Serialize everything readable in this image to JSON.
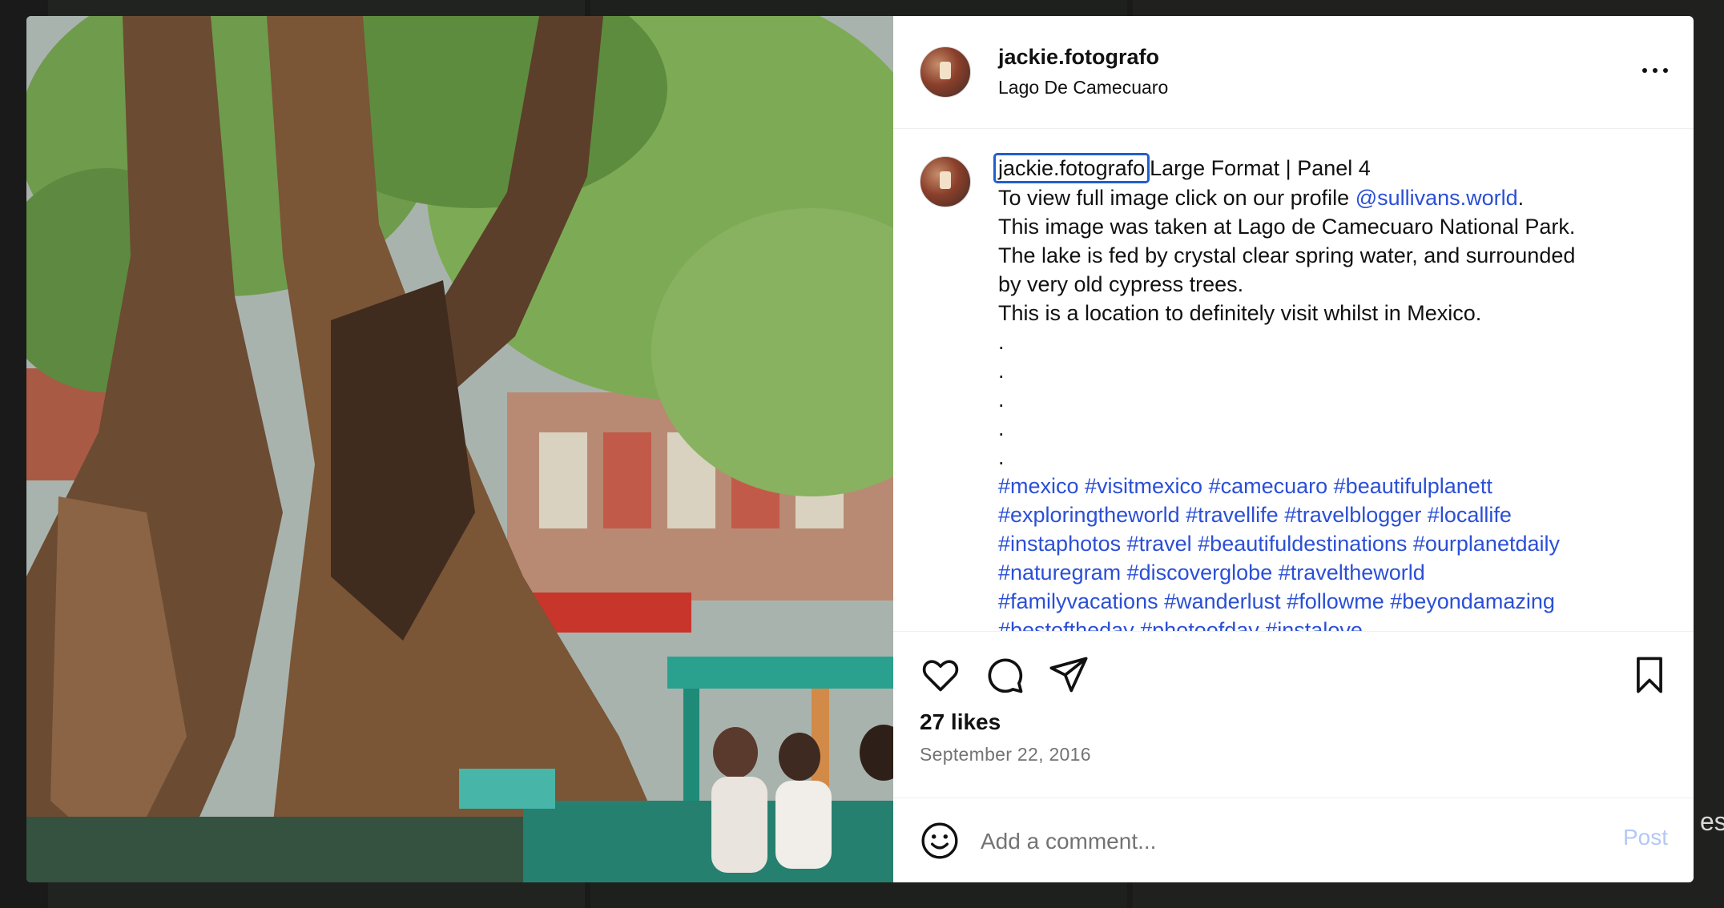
{
  "post": {
    "username": "jackie.fotografo",
    "location": "Lago De Camecuaro",
    "caption": {
      "username": "jackie.fotografo",
      "line1_after_user": "Large Format | Panel 4",
      "line2_text": "To view full image click on our profile ",
      "line2_mention": "@sullivans.world",
      "line2_end": ".",
      "line3": "This image was taken at Lago de Camecuaro National Park.",
      "line4": "The lake is fed by crystal clear spring water, and surrounded",
      "line5": "by very old cypress trees.",
      "line6": "This is a location to definitely visit whilst in Mexico.",
      "dots": [
        ".",
        ".",
        ".",
        ".",
        "."
      ],
      "hashtag_lines": [
        "#mexico #visitmexico #camecuaro #beautifulplanett",
        "#exploringtheworld #travellife #travelblogger #locallife",
        "#instaphotos #travel #beautifuldestinations #ourplanetdaily",
        "#naturegram #discoverglobe #traveltheworld",
        "#familyvacations #wanderlust #followme #beyondamazing",
        "#bestoftheday #photoofday #instalove"
      ]
    },
    "likes": "27 likes",
    "date": "September 22, 2016"
  },
  "comment": {
    "placeholder": "Add a comment...",
    "post_label": "Post"
  },
  "icons": {
    "like": "heart-icon",
    "comment": "comment-icon",
    "share": "send-icon",
    "save": "bookmark-icon",
    "emoji": "smiley-icon",
    "more": "more-options-icon"
  },
  "colors": {
    "link": "#2b4fd6",
    "post_button_disabled": "#b3c8f5",
    "focus_ring": "#1f5fcf"
  },
  "background": {
    "edge_text": "es"
  }
}
